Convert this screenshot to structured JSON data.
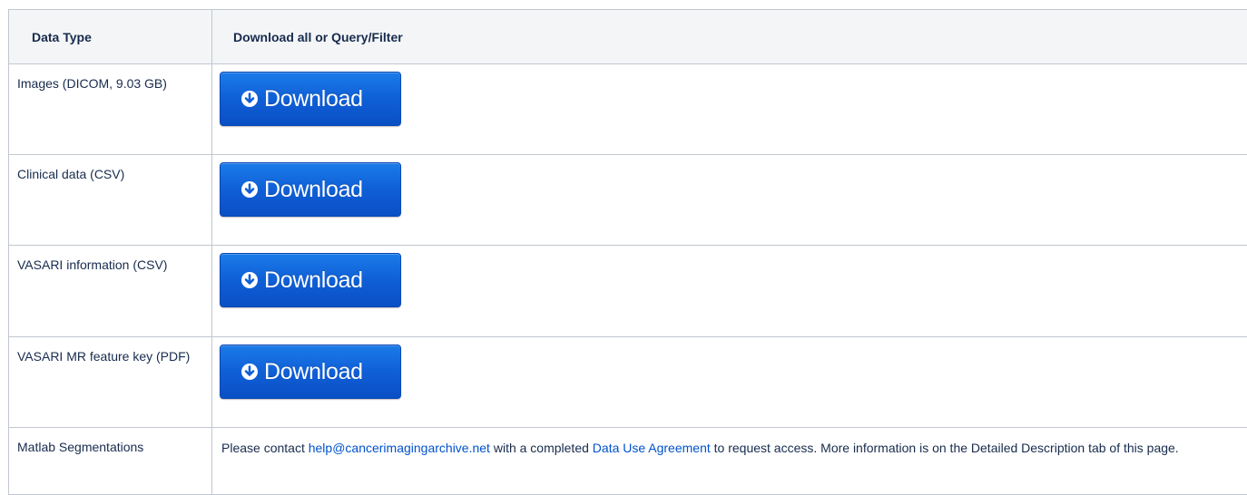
{
  "table": {
    "headers": {
      "data_type": "Data Type",
      "download": "Download all or Query/Filter"
    },
    "rows": [
      {
        "type": "Images (DICOM, 9.03 GB)",
        "button_label": "Download"
      },
      {
        "type": "Clinical data (CSV)",
        "button_label": "Download"
      },
      {
        "type": "VASARI information (CSV)",
        "button_label": "Download"
      },
      {
        "type": "VASARI MR feature key (PDF)",
        "button_label": "Download"
      }
    ],
    "last_row": {
      "type": "Matlab Segmentations",
      "text_before": "Please contact ",
      "email_link": "help@cancerimagingarchive.net",
      "text_middle": " with a completed ",
      "agreement_link": "Data Use Agreement",
      "text_after": " to request access.  More information is on the Detailed Description tab of this page."
    }
  },
  "colors": {
    "button": "#0f5fd7",
    "link": "#0052cc",
    "header_bg": "#f4f5f7",
    "border": "#c1c7d0"
  },
  "icons": {
    "download": "circle-arrow-down-icon"
  }
}
